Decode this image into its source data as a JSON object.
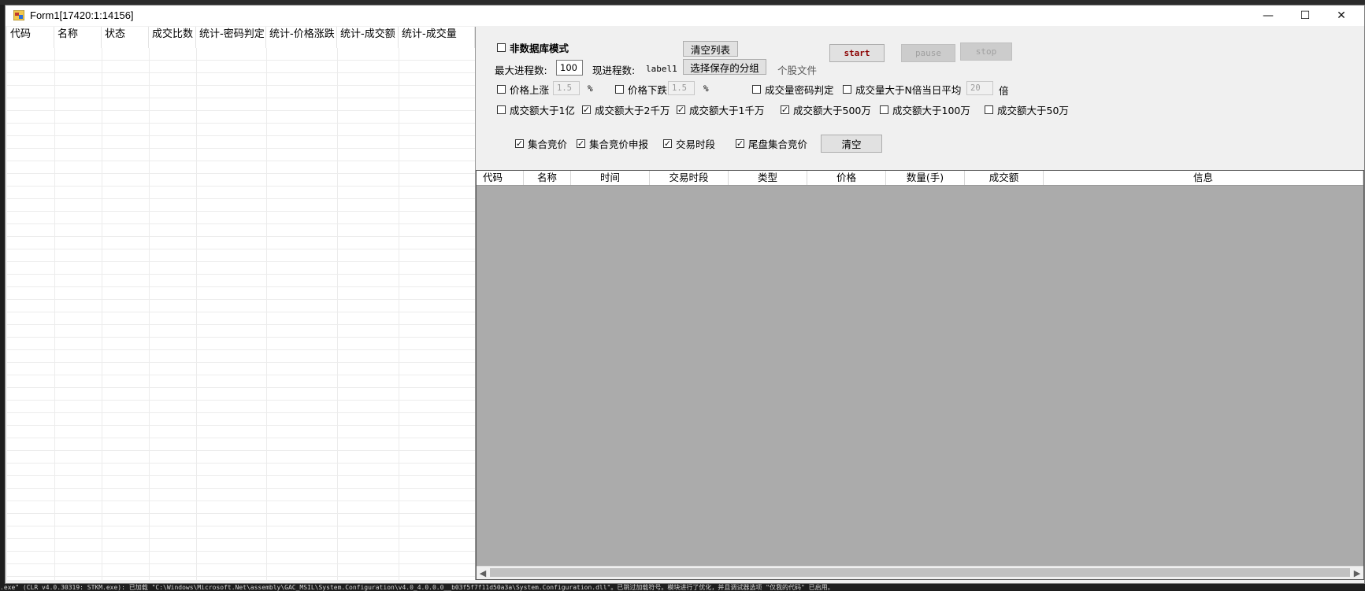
{
  "window": {
    "title": "Form1[17420:1:14156]",
    "controls": {
      "minimize": "—",
      "maximize": "☐",
      "close": "✕"
    }
  },
  "left_grid": {
    "columns": [
      "代码",
      "名称",
      "状态",
      "成交比数",
      "统计-密码判定",
      "统计-价格涨跌",
      "统计-成交额",
      "统计-成交量"
    ]
  },
  "settings": {
    "non_db_mode": {
      "label": "非数据库模式",
      "checked": false
    },
    "clear_list_button": "清空列表",
    "max_process_label": "最大进程数:",
    "max_process_value": "100",
    "current_process_label": "现进程数:",
    "current_process_value": "label1",
    "choose_group_button": "选择保存的分组",
    "stock_file_label": "个股文件",
    "start_button": "start",
    "pause_button": "pause",
    "stop_button": "stop",
    "price_up": {
      "label": "价格上涨",
      "checked": false,
      "value": "1.5",
      "unit": "%"
    },
    "price_down": {
      "label": "价格下跌",
      "checked": false,
      "value": "1.5",
      "unit": "%"
    },
    "volume_password": {
      "label": "成交量密码判定",
      "checked": false
    },
    "volume_n_times": {
      "label": "成交量大于N倍当日平均",
      "checked": false,
      "value": "20",
      "unit": "倍"
    },
    "amount_filters": [
      {
        "label": "成交额大于1亿",
        "checked": false
      },
      {
        "label": "成交额大于2千万",
        "checked": true
      },
      {
        "label": "成交额大于1千万",
        "checked": true
      },
      {
        "label": "成交额大于500万",
        "checked": true
      },
      {
        "label": "成交额大于100万",
        "checked": false
      },
      {
        "label": "成交额大于50万",
        "checked": false
      }
    ],
    "session_filters": [
      {
        "label": "集合竞价",
        "checked": true
      },
      {
        "label": "集合竞价申报",
        "checked": true
      },
      {
        "label": "交易时段",
        "checked": true
      },
      {
        "label": "尾盘集合竞价",
        "checked": true
      }
    ],
    "clear_button": "清空"
  },
  "result_grid": {
    "columns": [
      "代码",
      "名称",
      "时间",
      "交易时段",
      "类型",
      "价格",
      "数量(手)",
      "成交额",
      "信息"
    ]
  },
  "status_text": ".exe\" (CLR v4.0.30319: STKM.exe): 已加载 \"C:\\Windows\\Microsoft.Net\\assembly\\GAC_MSIL\\System.Configuration\\v4.0_4.0.0.0__b03f5f7f11d50a3a\\System.Configuration.dll\"。已跳过加载符号。模块进行了优化，并且调试器选项 \"仅我的代码\" 已启用。"
}
